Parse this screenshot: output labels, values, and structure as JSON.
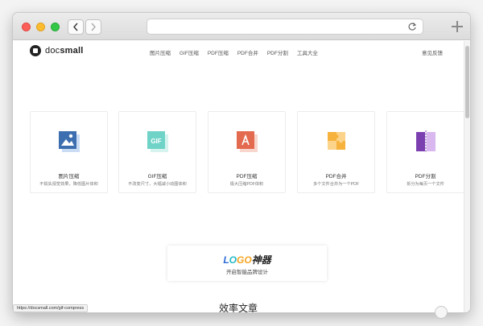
{
  "browser": {
    "address_value": ""
  },
  "header": {
    "logo_prefix": "doc",
    "logo_suffix": "small",
    "nav": [
      "图片压缩",
      "GIF压缩",
      "PDF压缩",
      "PDF合并",
      "PDF分割",
      "工具大全"
    ],
    "feedback": "意见反馈"
  },
  "tools": [
    {
      "title": "图片压缩",
      "desc": "不损失视觉效果，降低图片体积",
      "icon": "image-icon",
      "color": "#3d6fb0"
    },
    {
      "title": "GIF压缩",
      "desc": "不改变尺寸，大幅减小动图体积",
      "icon": "gif-icon",
      "color": "#6fd3c8"
    },
    {
      "title": "PDF压缩",
      "desc": "极大压缩PDF体积",
      "icon": "pdf-icon",
      "color": "#e36a4f"
    },
    {
      "title": "PDF合并",
      "desc": "多个文件合并为一个PDF",
      "icon": "puzzle-icon",
      "color": "#f6b23d"
    },
    {
      "title": "PDF分割",
      "desc": "拆分为每页一个文件",
      "icon": "split-icon",
      "color": "#7b3fb0"
    }
  ],
  "promo": {
    "logo_a": "L",
    "logo_b": "O",
    "logo_c": "GO",
    "logo_d": "神器",
    "tagline": "开启智能品牌设计"
  },
  "section_title": "效率文章",
  "status_url": "https://docsmall.com/gif-compress"
}
